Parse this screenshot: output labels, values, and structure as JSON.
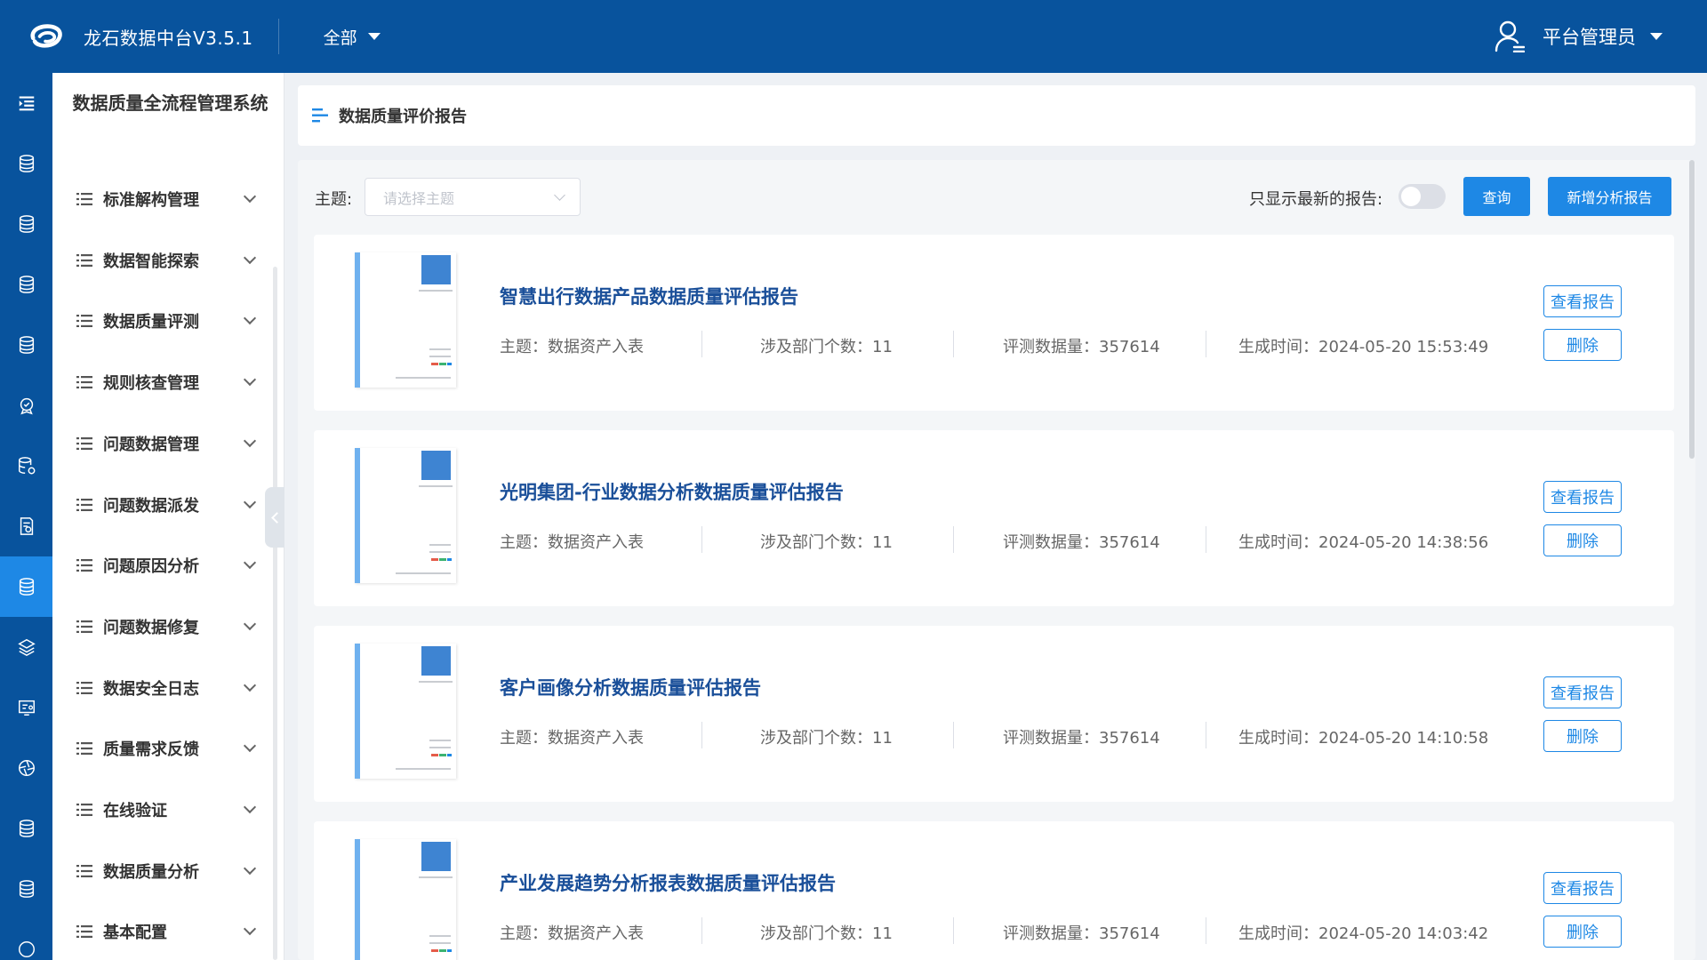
{
  "app": {
    "title": "龙石数据中台V3.5.1",
    "scope": "全部",
    "user": "平台管理员"
  },
  "sidebar": {
    "system_title": "数据质量全流程管理系统",
    "items": [
      {
        "label": "标准解构管理"
      },
      {
        "label": "数据智能探索"
      },
      {
        "label": "数据质量评测"
      },
      {
        "label": "规则核查管理"
      },
      {
        "label": "问题数据管理"
      },
      {
        "label": "问题数据派发"
      },
      {
        "label": "问题原因分析"
      },
      {
        "label": "问题数据修复"
      },
      {
        "label": "数据安全日志"
      },
      {
        "label": "质量需求反馈"
      },
      {
        "label": "在线验证"
      },
      {
        "label": "数据质量分析"
      },
      {
        "label": "基本配置"
      }
    ]
  },
  "breadcrumb": {
    "title": "数据质量评价报告"
  },
  "filters": {
    "theme_label": "主题:",
    "theme_placeholder": "请选择主题",
    "latest_label": "只显示最新的报告:",
    "latest_only": false,
    "query_button": "查询",
    "add_button": "新增分析报告"
  },
  "reports": [
    {
      "title": "智慧出行数据产品数据质量评估报告",
      "theme": "主题：数据资产入表",
      "departments": "涉及部门个数：11",
      "volume": "评测数据量：357614",
      "generated": "生成时间：2024-05-20 15:53:49",
      "view_label": "查看报告",
      "delete_label": "删除"
    },
    {
      "title": "光明集团-行业数据分析数据质量评估报告",
      "theme": "主题：数据资产入表",
      "departments": "涉及部门个数：11",
      "volume": "评测数据量：357614",
      "generated": "生成时间：2024-05-20 14:38:56",
      "view_label": "查看报告",
      "delete_label": "删除"
    },
    {
      "title": "客户画像分析数据质量评估报告",
      "theme": "主题：数据资产入表",
      "departments": "涉及部门个数：11",
      "volume": "评测数据量：357614",
      "generated": "生成时间：2024-05-20 14:10:58",
      "view_label": "查看报告",
      "delete_label": "删除"
    },
    {
      "title": "产业发展趋势分析报表数据质量评估报告",
      "theme": "主题：数据资产入表",
      "departments": "涉及部门个数：11",
      "volume": "评测数据量：357614",
      "generated": "生成时间：2024-05-20 14:03:42",
      "view_label": "查看报告",
      "delete_label": "删除"
    }
  ],
  "colors": {
    "topbar": "#08539d",
    "accent": "#1e88e5",
    "title_link": "#1a4f99"
  }
}
